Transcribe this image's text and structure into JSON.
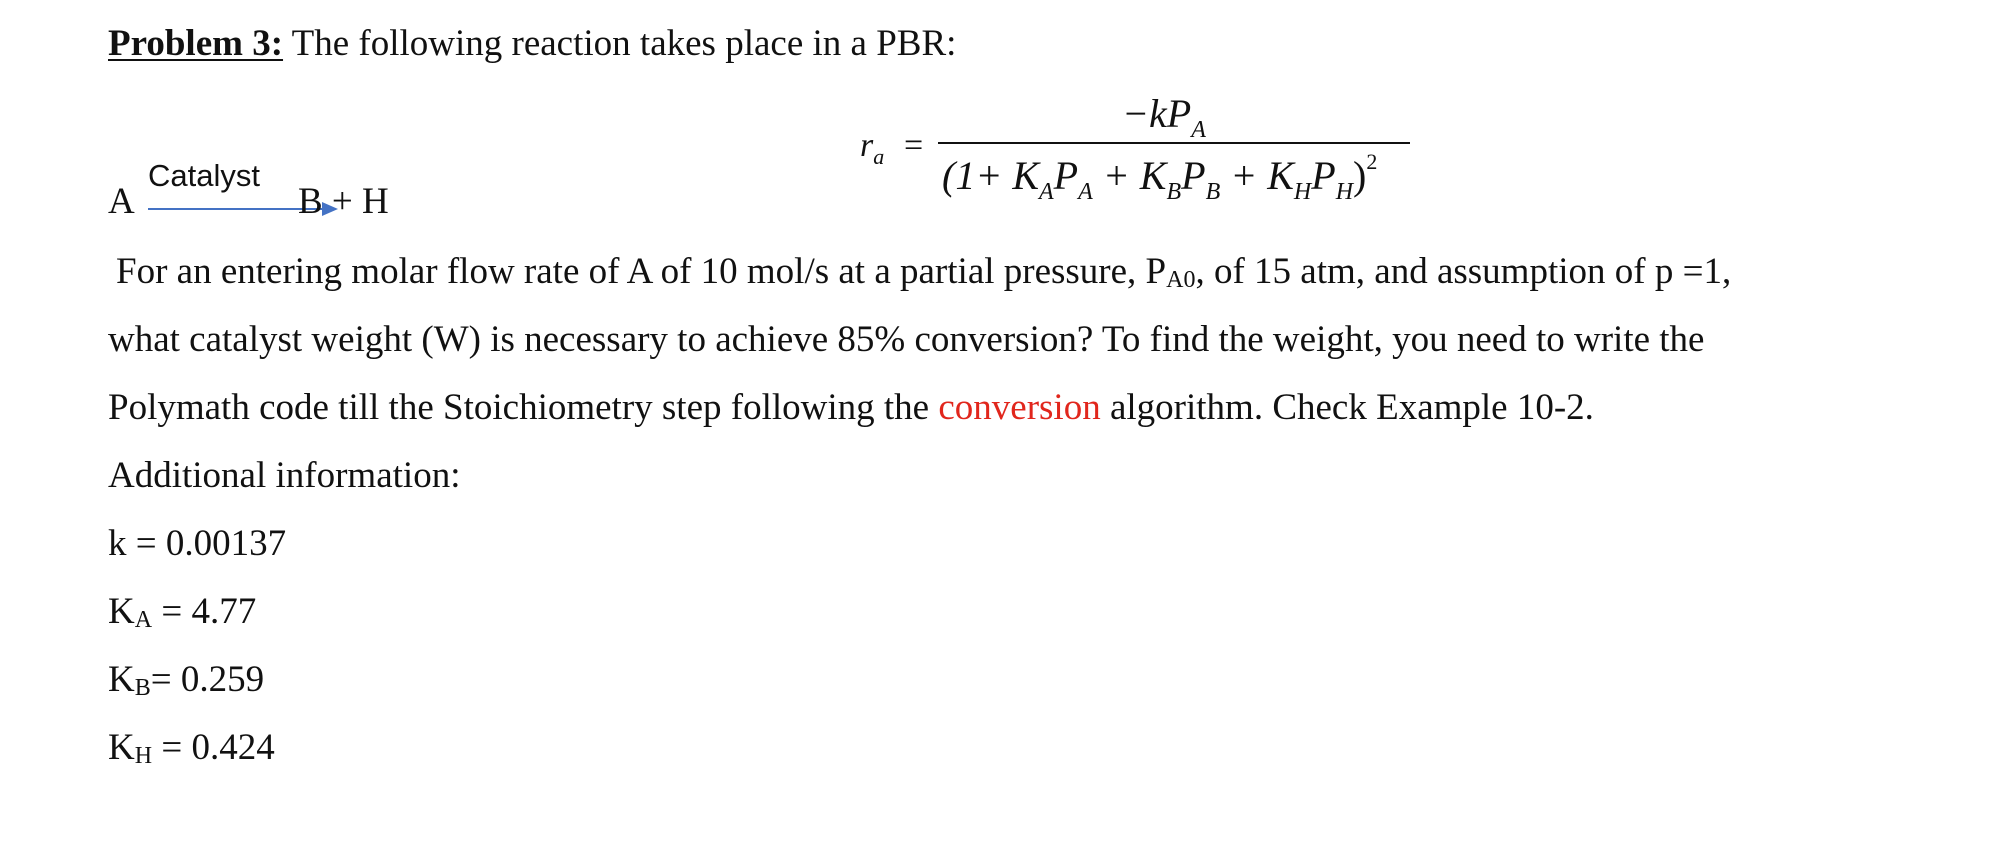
{
  "problem": {
    "label": "Problem 3:",
    "intro": " The following reaction takes place in a PBR:"
  },
  "reaction": {
    "reactant": "A",
    "catalyst_label": "Catalyst",
    "products": "B + H",
    "arrow_color": "#4472c4"
  },
  "rate_equation": {
    "lhs": "r",
    "lhs_sub": "a",
    "equals": "=",
    "numerator": "−kP",
    "numerator_sub": "A",
    "denominator_terms": [
      {
        "text": "(1+ K",
        "sub": "A"
      },
      {
        "text": "P",
        "sub": "A"
      },
      {
        "text": " + K",
        "sub": "B"
      },
      {
        "text": "P",
        "sub": "B"
      },
      {
        "text": " + K",
        "sub": "H"
      },
      {
        "text": "P",
        "sub": "H"
      }
    ],
    "close": ")",
    "exponent": "2"
  },
  "paragraph": {
    "line1_a": "For an entering molar flow rate of A of 10 mol/s at a partial pressure, P",
    "line1_sub": "A0",
    "line1_b": ", of 15 atm, and assumption of p =1,",
    "line2": "what catalyst weight (W) is necessary to achieve 85% conversion? To find the weight, you need to write the",
    "line3_a": "Polymath code till the Stoichiometry step following the ",
    "line3_highlight": "conversion",
    "line3_b": " algorithm. Check Example 10-2.",
    "highlight_color": "#e1261c"
  },
  "additional": {
    "heading": "Additional information:",
    "params": [
      {
        "symbol": "k",
        "sub": "",
        "value": " = 0.00137"
      },
      {
        "symbol": "K",
        "sub": "A",
        "value": " = 4.77"
      },
      {
        "symbol": "K",
        "sub": "B",
        "value": "= 0.259"
      },
      {
        "symbol": "K",
        "sub": "H",
        "value": " = 0.424"
      }
    ]
  }
}
